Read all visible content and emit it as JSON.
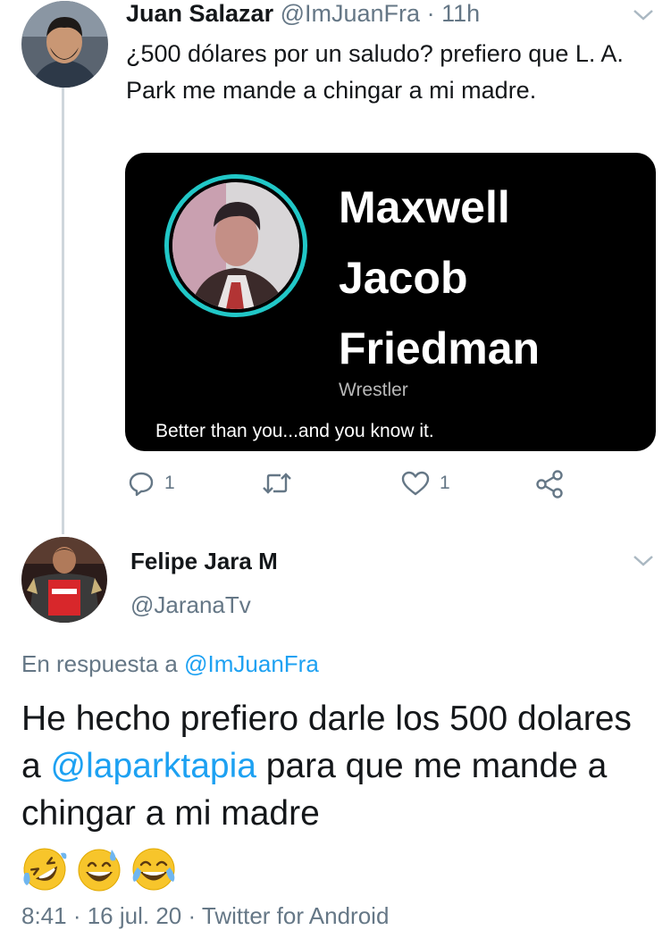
{
  "tweet1": {
    "name": "Juan Salazar",
    "handle": "@ImJuanFra",
    "time": "· 11h",
    "text": "¿500 dólares por un saludo? prefiero que L. A. Park me mande a chingar a mi madre.",
    "card": {
      "name_lines": [
        "Maxwell",
        "Jacob",
        "Friedman"
      ],
      "role": "Wrestler",
      "bio": "Better than you...and you know it."
    },
    "actions": {
      "reply_count": "1",
      "like_count": "1"
    }
  },
  "tweet2": {
    "name": "Felipe Jara M",
    "handle": "@JaranaTv",
    "reply_prefix": "En respuesta a",
    "reply_handle": "@ImJuanFra",
    "text_before": "He hecho prefiero darle los 500 dolares a",
    "mention": "@laparktapia",
    "text_after": "para que me mande a chingar a mi madre",
    "emojis": [
      "rolling-on-floor-laughing",
      "grinning-sweat",
      "tears-of-joy"
    ]
  },
  "footer_text": "8:41 · 16 jul. 20 · Twitter for Android",
  "colors": {
    "link": "#1da1f2",
    "muted": "#657786",
    "card_ring": "#21c7c7"
  }
}
